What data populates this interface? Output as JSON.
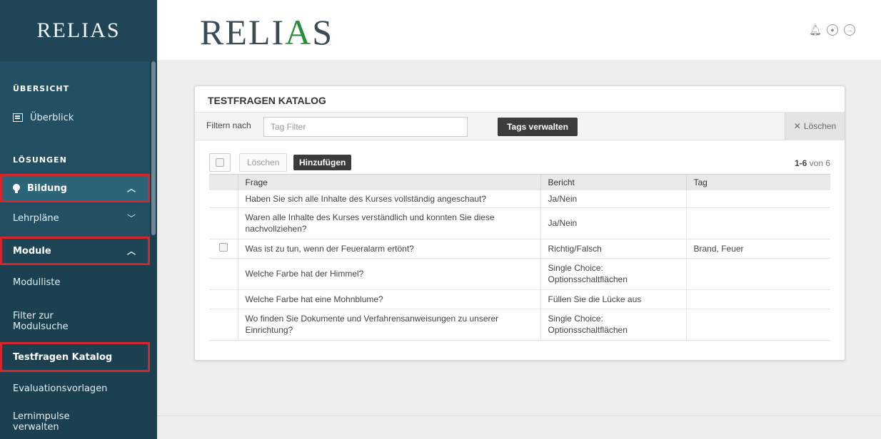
{
  "sidebar": {
    "logo": "RELIAS",
    "section_overview": "ÜBERSICHT",
    "overview_item": "Überblick",
    "section_solutions": "LÖSUNGEN",
    "items": [
      {
        "label": "Bildung"
      },
      {
        "label": "Lehrpläne"
      },
      {
        "label": "Module"
      },
      {
        "label": "Modulliste"
      },
      {
        "label": "Filter zur Modulsuche"
      },
      {
        "label": "Testfragen Katalog"
      },
      {
        "label": "Evaluationsvorlagen"
      },
      {
        "label": "Lernimpulse verwalten"
      }
    ]
  },
  "header": {
    "logo_left": "REL",
    "logo_mid": "I",
    "logo_a": "A",
    "logo_right": "S",
    "icons": [
      "bell-icon",
      "user-icon",
      "logout-icon"
    ]
  },
  "panel": {
    "title": "TESTFRAGEN KATALOG",
    "filter_label": "Filtern nach",
    "filter_placeholder": "Tag Filter",
    "manage_tags": "Tags verwalten",
    "clear_label": "Löschen",
    "delete_label": "Löschen",
    "add_label": "Hinzufügen",
    "pager_range": "1-6",
    "pager_of": "von 6"
  },
  "table": {
    "headers": [
      "Frage",
      "Bericht",
      "Tag"
    ],
    "rows": [
      {
        "frage": "Haben Sie sich alle Inhalte des Kurses vollständig angeschaut?",
        "bericht": "Ja/Nein",
        "tag": "",
        "checkbox": false
      },
      {
        "frage": "Waren alle Inhalte des Kurses verständlich und konnten Sie diese nachvollziehen?",
        "bericht": "Ja/Nein",
        "tag": "",
        "checkbox": false
      },
      {
        "frage": "Was ist zu tun, wenn der Feueralarm ertönt?",
        "bericht": "Richtig/Falsch",
        "tag": "Brand, Feuer",
        "checkbox": true
      },
      {
        "frage": "Welche Farbe hat der Himmel?",
        "bericht": "Single Choice: Optionsschaltflächen",
        "tag": "",
        "checkbox": false
      },
      {
        "frage": "Welche Farbe hat eine Mohnblume?",
        "bericht": "Füllen Sie die Lücke aus",
        "tag": "",
        "checkbox": false
      },
      {
        "frage": "Wo finden Sie Dokumente und Verfahrensanweisungen zu unserer Einrichtung?",
        "bericht": "Single Choice: Optionsschaltflächen",
        "tag": "",
        "checkbox": false
      }
    ]
  },
  "colors": {
    "sidebar_bg": "#234f62",
    "highlight": "#d7252c",
    "logo_accent": "#2a8d3a"
  }
}
